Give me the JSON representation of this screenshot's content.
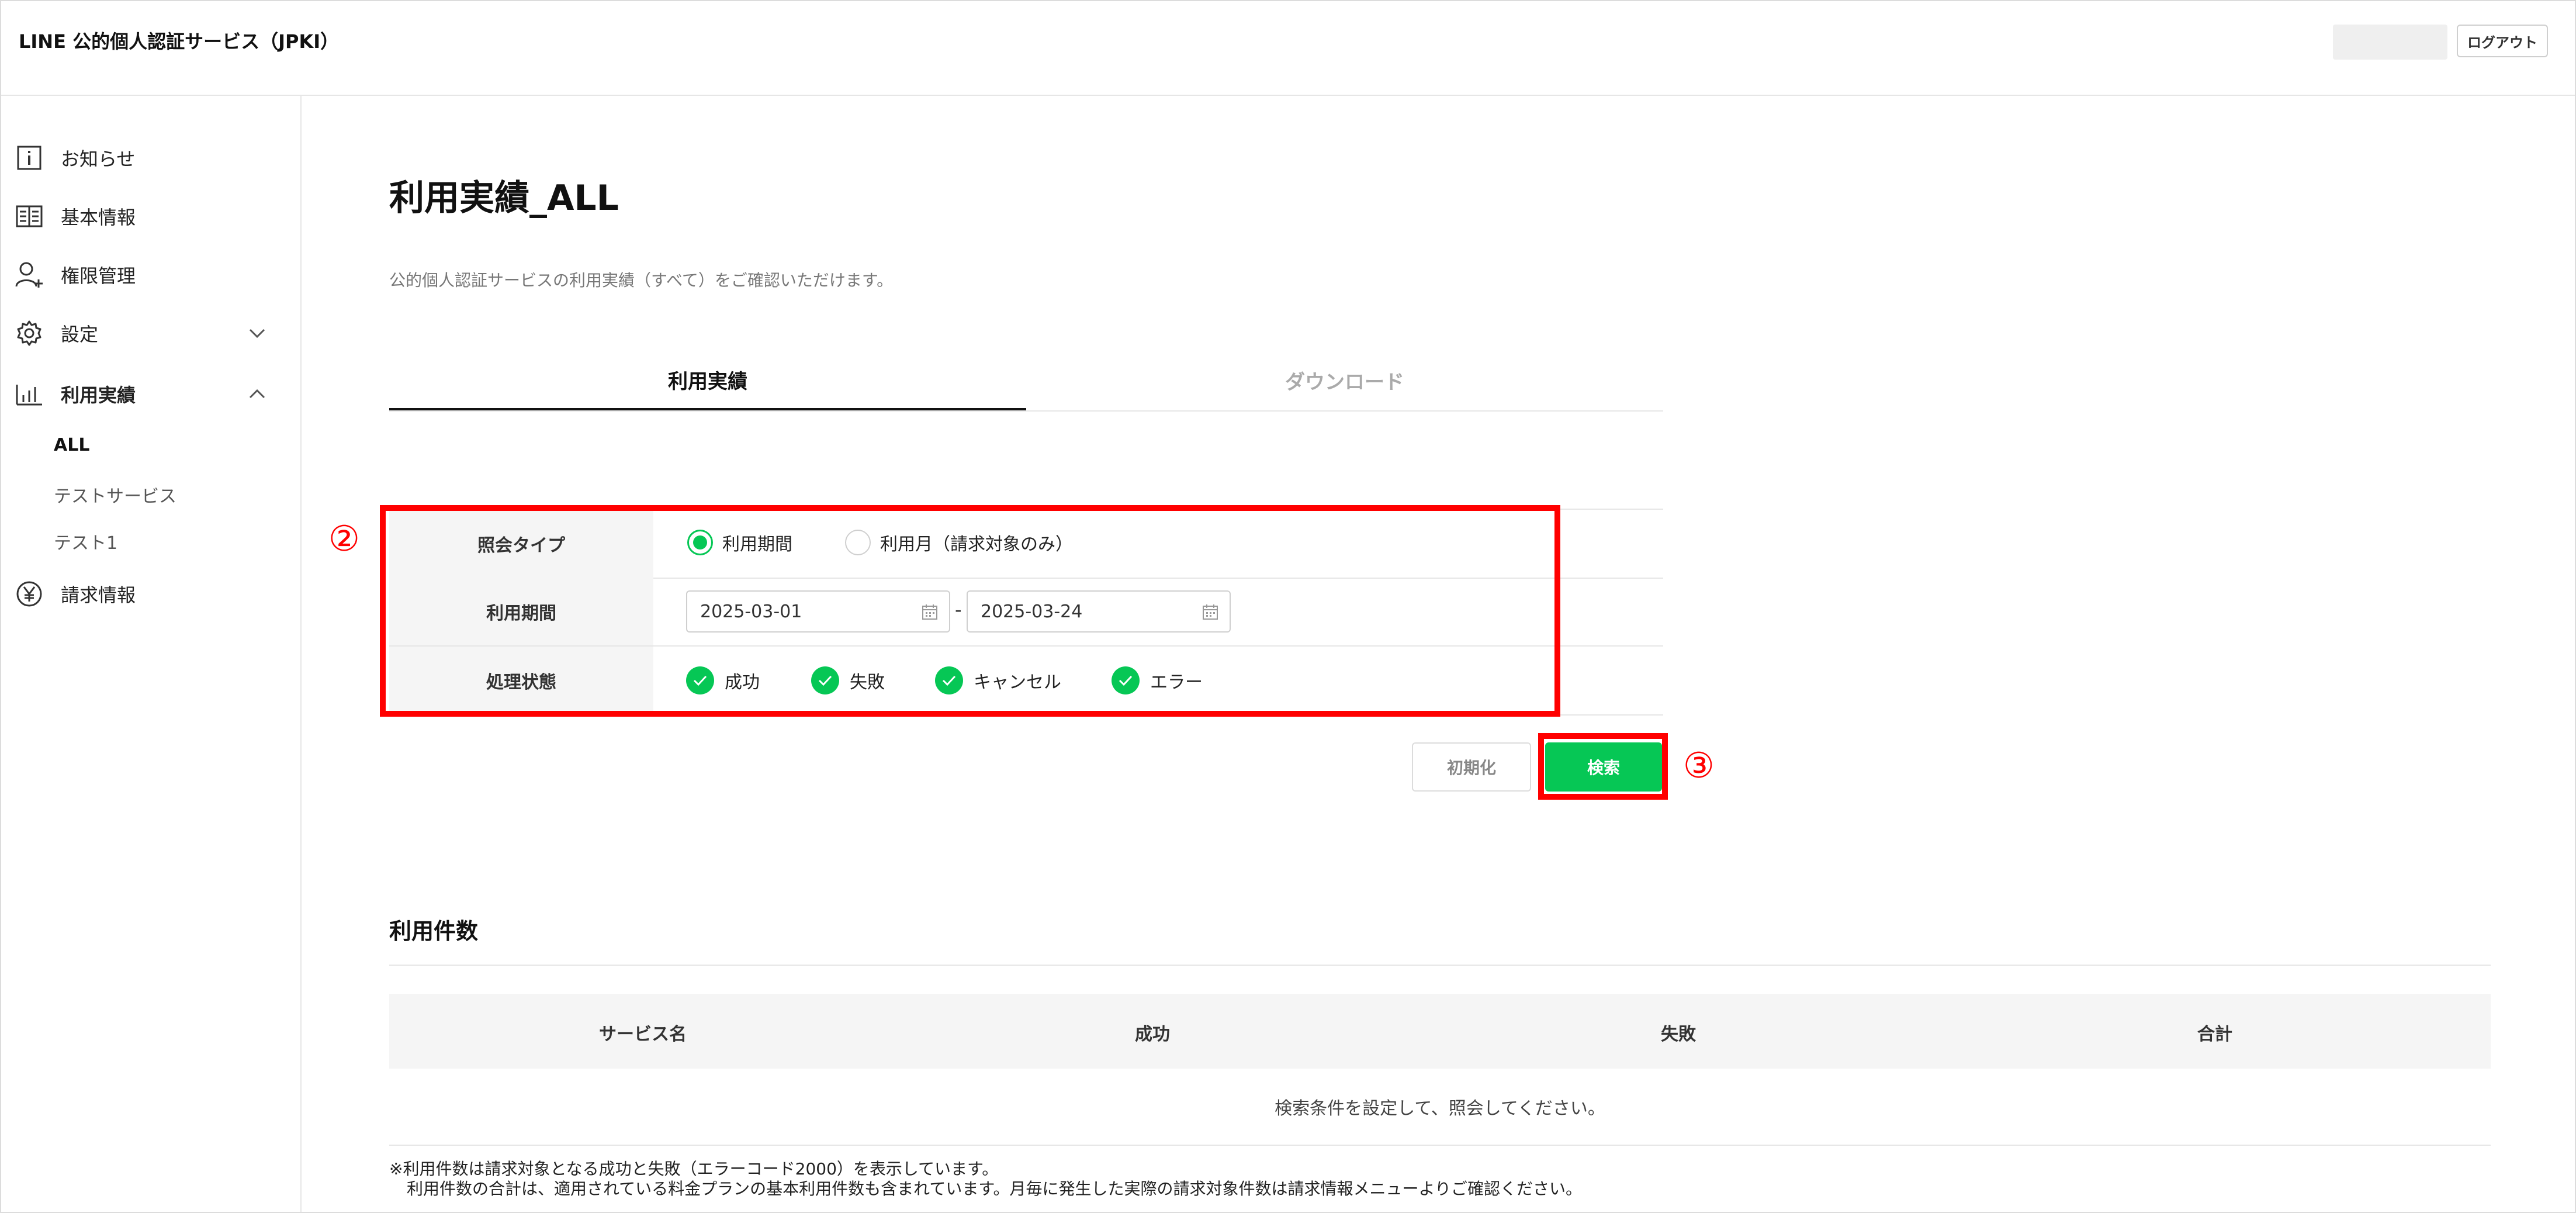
{
  "header": {
    "app_title": "LINE 公的個人認証サービス（JPKI）",
    "logout_label": "ログアウト"
  },
  "sidebar": {
    "items": [
      {
        "label": "お知らせ",
        "icon": "info-icon"
      },
      {
        "label": "基本情報",
        "icon": "book-icon"
      },
      {
        "label": "権限管理",
        "icon": "user-add-icon"
      },
      {
        "label": "設定",
        "icon": "gear-icon"
      },
      {
        "label": "利用実績",
        "icon": "bar-chart-icon"
      },
      {
        "label": "請求情報",
        "icon": "yen-icon"
      }
    ],
    "sub_items": [
      "ALL",
      "テストサービス",
      "テスト1"
    ]
  },
  "main": {
    "title": "利用実績_ALL",
    "description": "公的個人認証サービスの利用実績（すべて）をご確認いただけます。",
    "tabs": [
      {
        "label": "利用実績",
        "active": true
      },
      {
        "label": "ダウンロード",
        "active": false
      }
    ]
  },
  "form": {
    "inquiry_type": {
      "label": "照会タイプ",
      "options": [
        {
          "label": "利用期間",
          "selected": true
        },
        {
          "label": "利用月（請求対象のみ）",
          "selected": false
        }
      ]
    },
    "period": {
      "label": "利用期間",
      "start": "2025-03-01",
      "end": "2025-03-24",
      "separator": "-"
    },
    "status": {
      "label": "処理状態",
      "options": [
        {
          "label": "成功",
          "checked": true
        },
        {
          "label": "失敗",
          "checked": true
        },
        {
          "label": "キャンセル",
          "checked": true
        },
        {
          "label": "エラー",
          "checked": true
        }
      ]
    },
    "reset_label": "初期化",
    "search_label": "検索"
  },
  "annotations": {
    "form_marker": "②",
    "search_marker": "③",
    "highlight_color": "#ff0000"
  },
  "usage": {
    "title": "利用件数",
    "columns": [
      "サービス名",
      "成功",
      "失敗",
      "合計"
    ],
    "empty_message": "検索条件を設定して、照会してください。",
    "notes": [
      "※利用件数は請求対象となる成功と失敗（エラーコード2000）を表示しています。",
      "利用件数の合計は、適用されている料金プランの基本利用件数も含まれています。月毎に発生した実際の請求対象件数は請求情報メニューよりご確認ください。"
    ]
  },
  "colors": {
    "accent": "#06c755",
    "annotation": "#ff0000"
  }
}
